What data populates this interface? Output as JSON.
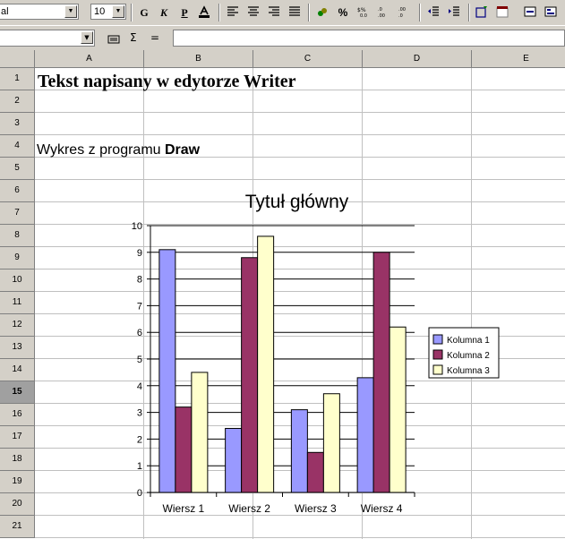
{
  "toolbar": {
    "font_name": "al",
    "font_size": "10",
    "bold_label": "G",
    "italic_label": "K",
    "underline_label": "P"
  },
  "sheet": {
    "columns": [
      "A",
      "B",
      "C",
      "D",
      "E"
    ],
    "rows": [
      "1",
      "2",
      "3",
      "4",
      "5",
      "6",
      "7",
      "8",
      "9",
      "10",
      "11",
      "12",
      "13",
      "14",
      "15",
      "16",
      "17",
      "18",
      "19",
      "20",
      "21"
    ],
    "active_row": "15",
    "a1_text": "Tekst napisany w edytorze Writer",
    "a4_text_prefix": "Wykres z programu ",
    "a4_text_bold": "Draw"
  },
  "chart_data": {
    "type": "bar",
    "title": "Tytuł główny",
    "categories": [
      "Wiersz 1",
      "Wiersz 2",
      "Wiersz 3",
      "Wiersz 4"
    ],
    "series": [
      {
        "name": "Kolumna 1",
        "values": [
          9.1,
          2.4,
          3.1,
          4.3
        ],
        "color": "#9999ff"
      },
      {
        "name": "Kolumna 2",
        "values": [
          3.2,
          8.8,
          1.5,
          9.0
        ],
        "color": "#993366"
      },
      {
        "name": "Kolumna 3",
        "values": [
          4.5,
          9.6,
          3.7,
          6.2
        ],
        "color": "#ffffcc"
      }
    ],
    "ylim": [
      0,
      10
    ],
    "yticks": [
      "0",
      "1",
      "2",
      "3",
      "4",
      "5",
      "6",
      "7",
      "8",
      "9",
      "10"
    ],
    "grid": true,
    "legend": "right"
  }
}
